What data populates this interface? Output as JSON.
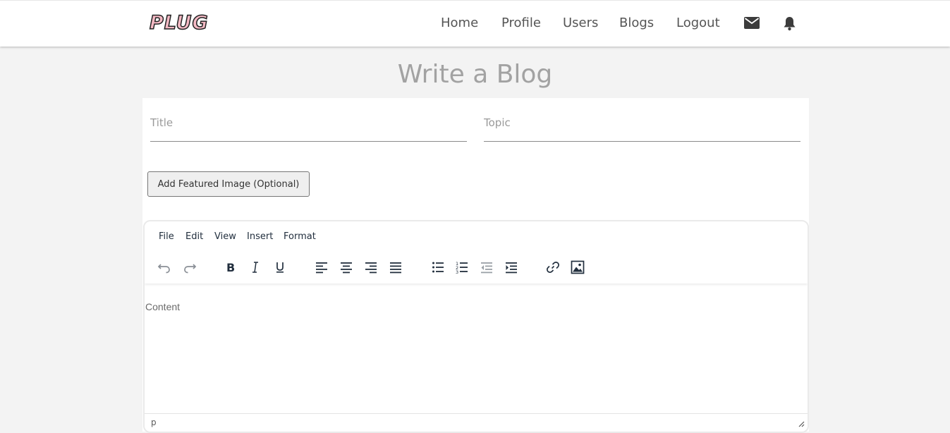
{
  "nav": {
    "logo": "PLUG",
    "links": [
      "Home",
      "Profile",
      "Users",
      "Blogs",
      "Logout"
    ],
    "icons": [
      "mail-icon",
      "bell-icon"
    ]
  },
  "page": {
    "title": "Write a Blog"
  },
  "form": {
    "title_placeholder": "Title",
    "topic_placeholder": "Topic",
    "image_button": "Add Featured Image (Optional)"
  },
  "editor": {
    "menu": [
      "File",
      "Edit",
      "View",
      "Insert",
      "Format"
    ],
    "toolbar_icons": [
      "undo-icon",
      "redo-icon",
      "bold-icon",
      "italic-icon",
      "underline-icon",
      "align-left-icon",
      "align-center-icon",
      "align-right-icon",
      "align-justify-icon",
      "bullet-list-icon",
      "numbered-list-icon",
      "outdent-icon",
      "indent-icon",
      "link-icon",
      "image-icon"
    ],
    "placeholder": "Content",
    "status_path": "p"
  },
  "colors": {
    "logo_fill": "#f4b9c4",
    "title_gray": "#a2a2a2",
    "background": "#f3f3f3"
  }
}
